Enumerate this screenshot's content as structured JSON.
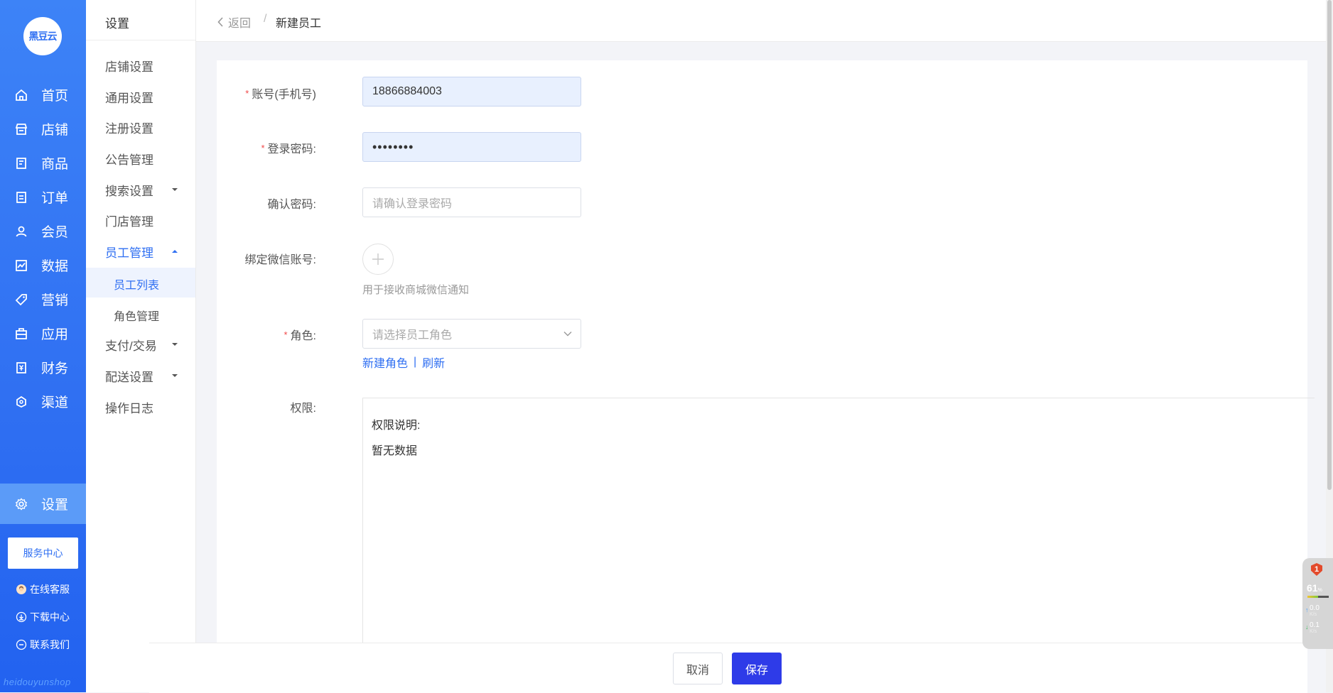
{
  "app": {
    "logo_text": "黑豆云",
    "brand_mark": "heidouyunshop"
  },
  "sidebar": {
    "items": [
      {
        "label": "首页",
        "icon": "home-icon"
      },
      {
        "label": "店铺",
        "icon": "store-icon"
      },
      {
        "label": "商品",
        "icon": "goods-icon"
      },
      {
        "label": "订单",
        "icon": "order-icon"
      },
      {
        "label": "会员",
        "icon": "member-icon"
      },
      {
        "label": "数据",
        "icon": "chart-icon"
      },
      {
        "label": "营销",
        "icon": "tag-icon"
      },
      {
        "label": "应用",
        "icon": "app-icon"
      },
      {
        "label": "财务",
        "icon": "finance-icon"
      },
      {
        "label": "渠道",
        "icon": "channel-icon"
      },
      {
        "label": "设置",
        "icon": "gear-icon",
        "active": true
      }
    ],
    "service_center": "服务中心",
    "links": [
      {
        "label": "在线客服",
        "icon": "customer-service-icon"
      },
      {
        "label": "下载中心",
        "icon": "download-icon"
      },
      {
        "label": "联系我们",
        "icon": "contact-icon"
      }
    ]
  },
  "submenu": {
    "title": "设置",
    "items": [
      {
        "label": "店铺设置"
      },
      {
        "label": "通用设置"
      },
      {
        "label": "注册设置"
      },
      {
        "label": "公告管理"
      },
      {
        "label": "搜索设置",
        "expandable": true
      },
      {
        "label": "门店管理"
      },
      {
        "label": "员工管理",
        "expandable": true,
        "open": true
      },
      {
        "label": "支付/交易",
        "expandable": true
      },
      {
        "label": "配送设置",
        "expandable": true
      },
      {
        "label": "操作日志"
      }
    ],
    "children": [
      "员工列表",
      "角色管理"
    ]
  },
  "header": {
    "back": "返回",
    "separator": "/",
    "current": "新建员工"
  },
  "form": {
    "account": {
      "label": "账号(手机号)",
      "required": true,
      "value": "18866884003"
    },
    "password": {
      "label": "登录密码",
      "required": true,
      "value": "••••••••"
    },
    "confirm": {
      "label": "确认密码",
      "required": false,
      "placeholder": "请确认登录密码"
    },
    "wechat": {
      "label": "绑定微信账号",
      "tip": "用于接收商城微信通知"
    },
    "role": {
      "label": "角色",
      "required": true,
      "placeholder": "请选择员工角色",
      "new_role": "新建角色",
      "divider": "|",
      "refresh": "刷新"
    },
    "permission": {
      "label": "权限",
      "title": "权限说明:",
      "empty": "暂无数据"
    }
  },
  "footer": {
    "cancel": "取消",
    "save": "保存"
  },
  "monitor": {
    "badge": "1",
    "percent": "61",
    "percent_unit": "%",
    "up": "0.0",
    "down": "0.1",
    "unit": "K/s"
  }
}
